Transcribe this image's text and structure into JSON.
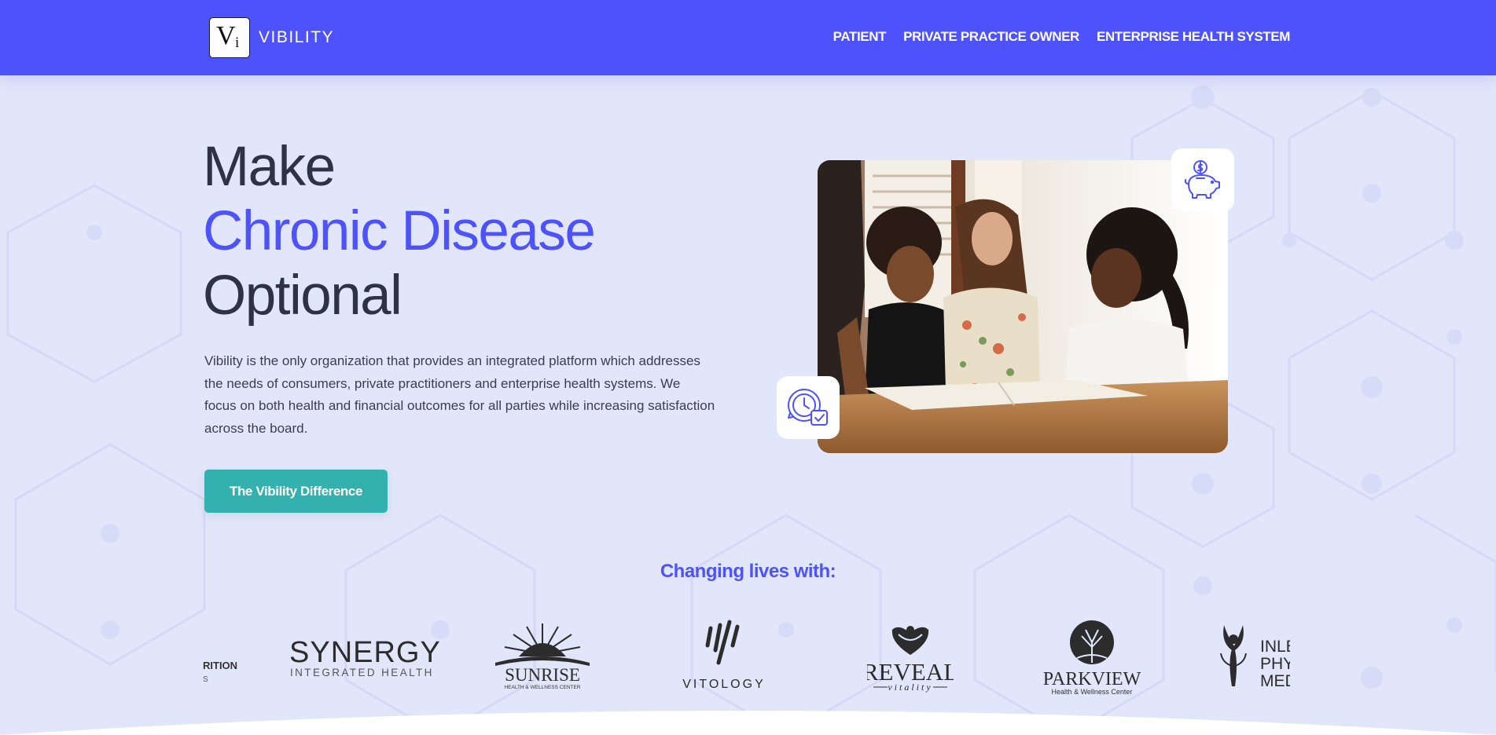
{
  "header": {
    "logo_initials_main": "V",
    "logo_initials_sub": "i",
    "brand": "VIBILITY",
    "nav": [
      "PATIENT",
      "PRIVATE PRACTICE OWNER",
      "ENTERPRISE HEALTH SYSTEM"
    ]
  },
  "hero": {
    "title_line1": "Make",
    "title_line2": "Chronic Disease",
    "title_line3": "Optional",
    "description": "Vibility is the only organization that provides an integrated platform which addresses the needs of consumers, private practitioners and enterprise health systems. We focus on both health and financial outcomes for all parties while increasing satisfaction across the board.",
    "cta_label": "The Vibility Difference"
  },
  "partners": {
    "heading": "Changing lives with:",
    "logos": [
      {
        "name": "partial-logo",
        "text1": "RITION",
        "text2": "S"
      },
      {
        "name": "synergy",
        "text1": "SYNERGY",
        "text2": "INTEGRATED HEALTH"
      },
      {
        "name": "sunrise",
        "text1": "SUNRISE",
        "text2": "HEALTH & WELLNESS CENTER"
      },
      {
        "name": "vitology",
        "text1": "VITOLOGY"
      },
      {
        "name": "reveal",
        "text1": "REVEAL",
        "text2": "vitality"
      },
      {
        "name": "parkview",
        "text1": "PARKVIEW",
        "text2": "Health & Wellness Center"
      },
      {
        "name": "inlet",
        "text1": "INLE",
        "text2": "PHY",
        "text3": "MED"
      }
    ]
  },
  "colors": {
    "brand_blue": "#4d52fa",
    "teal": "#33b1ae",
    "dark_text": "#2f3246",
    "page_bg": "#e2e6fb"
  },
  "icons": [
    "piggy-bank-icon",
    "clock-check-icon"
  ]
}
